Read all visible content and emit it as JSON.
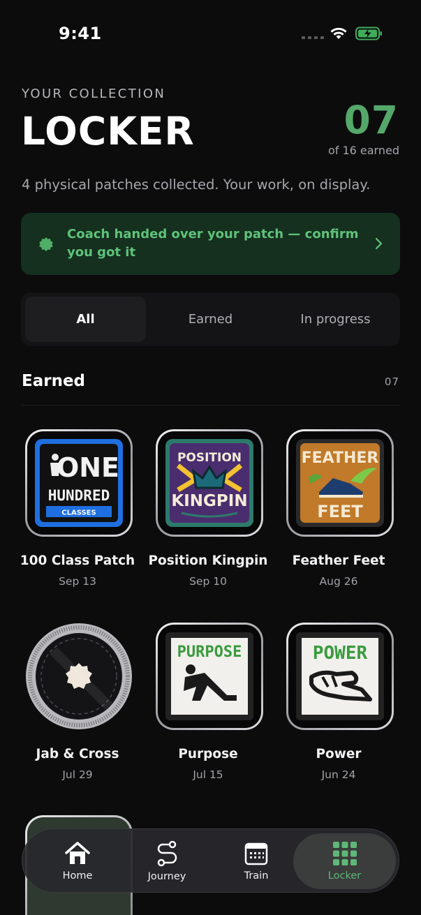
{
  "status": {
    "time": "9:41"
  },
  "header": {
    "eyebrow": "YOUR COLLECTION",
    "title": "LOCKER",
    "count": "07",
    "count_label": "of 16 earned",
    "subtitle": "4 physical patches collected. Your work, on display."
  },
  "banner": {
    "text": "Coach handed over your patch — confirm you got it",
    "icon": "badge-icon",
    "accent": "#5fc27a"
  },
  "segments": [
    {
      "label": "All",
      "active": true
    },
    {
      "label": "Earned",
      "active": false
    },
    {
      "label": "In progress",
      "active": false
    }
  ],
  "section": {
    "title": "Earned",
    "count": "07"
  },
  "patches": [
    {
      "name": "100 Class Patch",
      "date": "Sep 13",
      "art": {
        "line1": "ONE",
        "line2": "HUNDRED",
        "line3": "CLASSES"
      }
    },
    {
      "name": "Position Kingpin",
      "date": "Sep 10",
      "art": {
        "line1": "POSITION",
        "line2": "KINGPIN"
      }
    },
    {
      "name": "Feather Feet",
      "date": "Aug 26",
      "art": {
        "line1": "FEATHER",
        "line2": "FEET"
      }
    },
    {
      "name": "Jab & Cross",
      "date": "Jul 29"
    },
    {
      "name": "Purpose",
      "date": "Jul 15",
      "art": {
        "line1": "PURPOSE"
      }
    },
    {
      "name": "Power",
      "date": "Jun 24",
      "art": {
        "line1": "POWER"
      }
    }
  ],
  "tabs": [
    {
      "label": "Home",
      "icon": "home-icon"
    },
    {
      "label": "Journey",
      "icon": "route-icon"
    },
    {
      "label": "Train",
      "icon": "calendar-icon"
    },
    {
      "label": "Locker",
      "icon": "grid-icon",
      "active": true
    }
  ],
  "colors": {
    "accent": "#54a86a",
    "background": "#0c0c0d",
    "banner_bg": "#15301f"
  }
}
